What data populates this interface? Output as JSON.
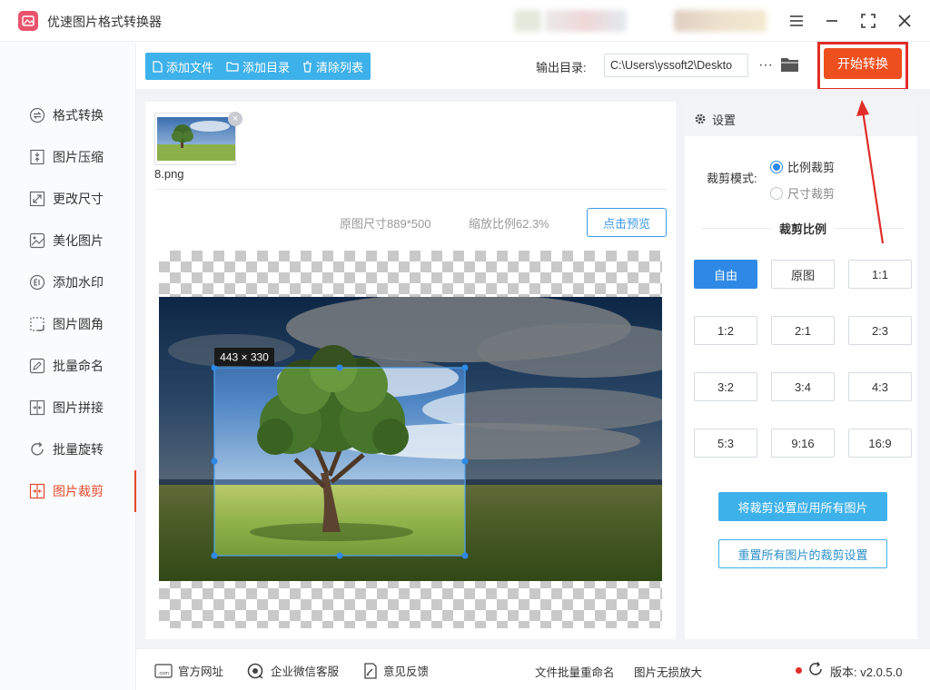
{
  "window": {
    "title": "优速图片格式转换器",
    "controls": [
      "menu-icon",
      "minimize-icon",
      "fullscreen-icon",
      "close-icon"
    ]
  },
  "sidebar": {
    "items": [
      {
        "label": "格式转换",
        "icon": "format-convert-icon"
      },
      {
        "label": "图片压缩",
        "icon": "compress-icon"
      },
      {
        "label": "更改尺寸",
        "icon": "resize-icon"
      },
      {
        "label": "美化图片",
        "icon": "beautify-icon"
      },
      {
        "label": "添加水印",
        "icon": "watermark-icon"
      },
      {
        "label": "图片圆角",
        "icon": "rounded-corner-icon"
      },
      {
        "label": "批量命名",
        "icon": "rename-icon"
      },
      {
        "label": "图片拼接",
        "icon": "stitch-icon"
      },
      {
        "label": "批量旋转",
        "icon": "rotate-icon"
      },
      {
        "label": "图片裁剪",
        "icon": "crop-icon",
        "active": true
      }
    ]
  },
  "toolbar": {
    "add_file": "添加文件",
    "add_folder": "添加目录",
    "clear_list": "清除列表",
    "output_label": "输出目录:",
    "output_path": "C:\\Users\\yssoft2\\Deskto",
    "more": "···",
    "start": "开始转换"
  },
  "file": {
    "name": "8.png",
    "close": "×"
  },
  "preview": {
    "original_size": "原图尺寸889*500",
    "scale": "缩放比例62.3%",
    "preview_button": "点击预览",
    "crop_label": "443 × 330"
  },
  "settings": {
    "header": "设置",
    "mode_label": "裁剪模式:",
    "mode_ratio": "比例裁剪",
    "mode_size": "尺寸裁剪",
    "selected_mode": "比例裁剪",
    "ratio_title": "裁剪比例",
    "ratios": [
      "自由",
      "原图",
      "1:1",
      "1:2",
      "2:1",
      "2:3",
      "3:2",
      "3:4",
      "4:3",
      "5:3",
      "9:16",
      "16:9"
    ],
    "selected_ratio": "自由",
    "apply_all": "将裁剪设置应用所有图片",
    "reset_all": "重置所有图片的裁剪设置"
  },
  "footer": {
    "website": "官方网址",
    "wechat": "企业微信客服",
    "feedback": "意见反馈",
    "link1": "文件批量重命名",
    "link2": "图片无损放大",
    "version": "版本:  v2.0.5.0"
  },
  "colors": {
    "accent": "#3db1ea",
    "primary_blue": "#2e89e6",
    "start_button": "#ee4f1f",
    "highlight_red": "#e02d28",
    "active_nav": "#e54a2d"
  }
}
